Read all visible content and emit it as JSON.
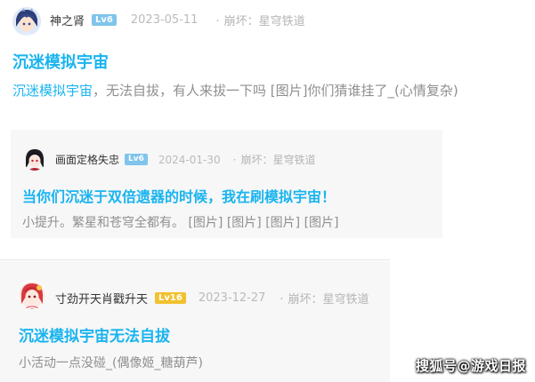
{
  "posts": [
    {
      "username": "神之肾",
      "level": "Lv6",
      "date": "2023-05-11",
      "forum_dot": "·",
      "forum": "崩坏：星穹铁道",
      "title": "沉迷模拟宇宙",
      "content_highlight": "沉迷模拟宇宙",
      "content_rest": "，无法自拔，有人来拔一下吗 [图片]你们猜谁挂了_(心情复杂)",
      "level_color": "#7fc4ec"
    },
    {
      "username": "画面定格失忠",
      "level": "Lv6",
      "date": "2024-01-30",
      "forum_dot": "·",
      "forum": "崩坏：星穹铁道",
      "title": "当你们沉迷于双倍遗器的时候，我在刷模拟宇宙！",
      "content": "小提升。繁星和苍穹全都有。 [图片] [图片] [图片] [图片]",
      "level_color": "#7fc4ec"
    },
    {
      "username": "寸劲开天肖戳升天",
      "level": "Lv16",
      "date": "2023-12-27",
      "forum_dot": "·",
      "forum": "崩坏：星穹铁道",
      "title": "沉迷模拟宇宙无法自拔",
      "content": "小活动一点没碰_(偶像姬_糖葫芦)",
      "level_color": "#f2c12e"
    }
  ],
  "watermark": "搜狐号@游戏日报",
  "colors": {
    "accent": "#19b4f0",
    "text_muted": "#8f8f8f",
    "meta": "#bbbbbb"
  }
}
